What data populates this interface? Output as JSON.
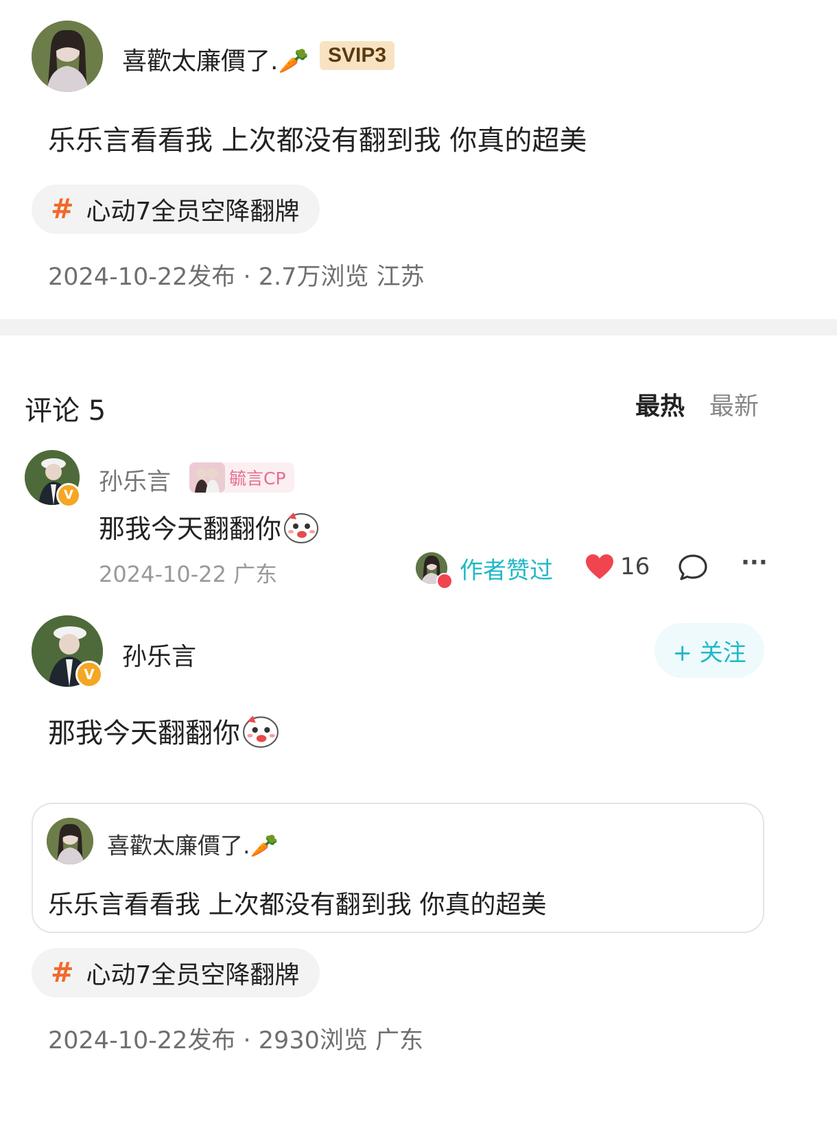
{
  "post": {
    "author_name": "喜歡太廉價了.",
    "author_emoji": "🥕",
    "vip_badge": "SVIP3",
    "text": "乐乐言看看我 上次都没有翻到我 你真的超美",
    "topic_hash": "#",
    "topic": "心动7全员空降翻牌",
    "meta": "2024-10-22发布 · 2.7万浏览  江苏"
  },
  "comments_header": {
    "title": "评论 5",
    "sort_hot": "最热",
    "sort_new": "最新"
  },
  "comment": {
    "author_name": "孙乐言",
    "verified_mark": "V",
    "cp_tag": "毓言CP",
    "text": "那我今天翻翻你",
    "date_location": "2024-10-22  广东",
    "author_liked": "作者赞过",
    "like_count": "16",
    "more": "···"
  },
  "reply_post": {
    "author_name": "孙乐言",
    "verified_mark": "V",
    "follow_label": "+ 关注",
    "text": "那我今天翻翻你",
    "quote": {
      "author_name": "喜歡太廉價了.",
      "author_emoji": "🥕",
      "text": "乐乐言看看我 上次都没有翻到我 你真的超美"
    },
    "topic_hash": "#",
    "topic": "心动7全员空降翻牌",
    "meta": "2024-10-22发布 · 2930浏览  广东"
  },
  "colors": {
    "accent_teal": "#20b8c7",
    "hash_orange": "#f06a2a",
    "heart_red": "#f0454f",
    "verified_orange": "#f5a623"
  }
}
